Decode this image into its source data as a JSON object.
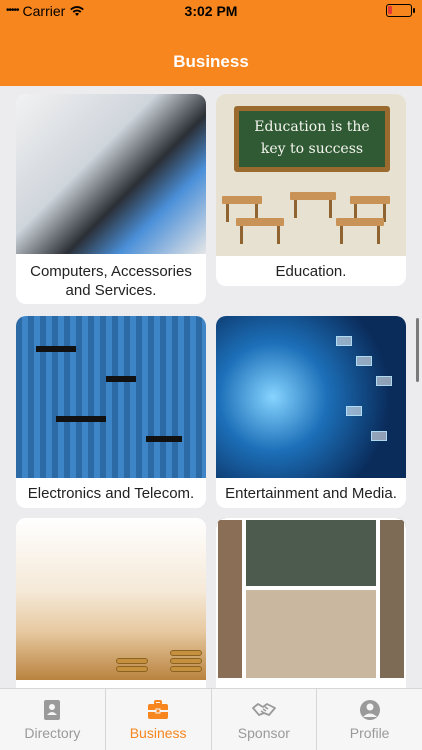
{
  "status_bar": {
    "carrier": "Carrier",
    "time": "3:02 PM",
    "battery_level": 0.1
  },
  "header": {
    "title": "Business",
    "bg_color": "#F7861E"
  },
  "categories": [
    {
      "label": "Computers, Accessories and Services."
    },
    {
      "label": "Education."
    },
    {
      "label": "Electronics and Telecom."
    },
    {
      "label": "Entertainment and Media."
    },
    {
      "label": ""
    },
    {
      "label": ""
    }
  ],
  "education_board": {
    "line1": "Education is the",
    "line2": "key to success"
  },
  "tabs": [
    {
      "label": "Directory",
      "icon": "contact-book-icon",
      "active": false
    },
    {
      "label": "Business",
      "icon": "briefcase-icon",
      "active": true
    },
    {
      "label": "Sponsor",
      "icon": "handshake-icon",
      "active": false
    },
    {
      "label": "Profile",
      "icon": "person-icon",
      "active": false
    }
  ],
  "colors": {
    "accent": "#F7861E",
    "inactive": "#9A9A9A"
  }
}
